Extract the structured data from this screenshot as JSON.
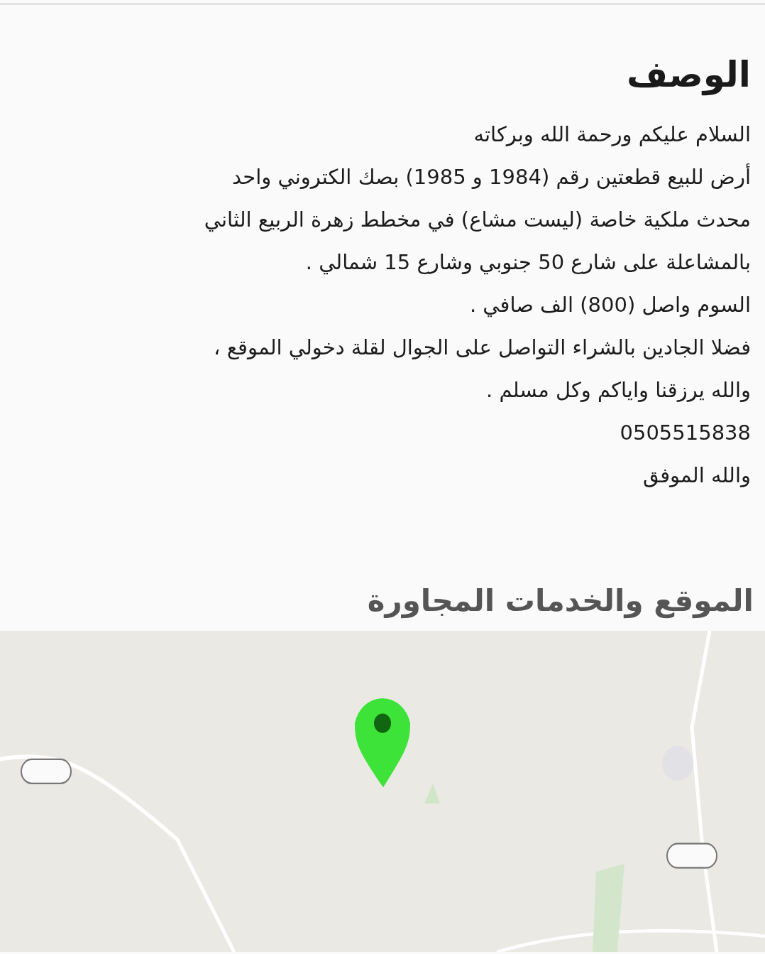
{
  "description": {
    "title": "الوصف",
    "lines": [
      "السلام عليكم ورحمة الله وبركاته",
      "أرض للبيع قطعتين رقم (1984 و 1985) بصك الكتروني واحد",
      "محدث ملكية خاصة (ليست مشاع) في مخطط زهرة الربيع الثاني",
      "بالمشاعلة على شارع 50 جنوبي وشارع 15 شمالي .",
      "السوم واصل (800) الف صافي .",
      "فضلا الجادين بالشراء التواصل على الجوال لقلة دخولي الموقع ،",
      "والله يرزقنا واياكم وكل مسلم .",
      "0505515838",
      "والله الموفق"
    ]
  },
  "location": {
    "title": "الموقع والخدمات المجاورة"
  }
}
